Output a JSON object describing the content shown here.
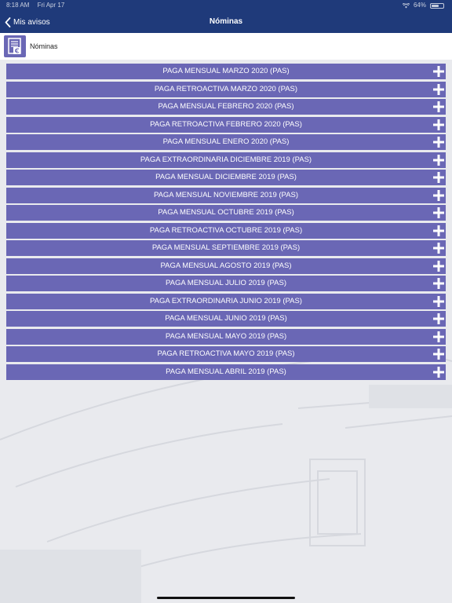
{
  "status_bar": {
    "time": "8:18 AM",
    "date": "Fri Apr 17",
    "battery": "64%",
    "battery_level": 0.64
  },
  "nav": {
    "back_label": "Mis avisos",
    "title": "Nóminas"
  },
  "section": {
    "title": "Nóminas",
    "icon": "payslip-euro-icon"
  },
  "rows": [
    {
      "label": "PAGA MENSUAL MARZO 2020 (PAS)"
    },
    {
      "label": "PAGA RETROACTIVA MARZO 2020 (PAS)"
    },
    {
      "label": "PAGA MENSUAL FEBRERO 2020 (PAS)"
    },
    {
      "label": "PAGA RETROACTIVA FEBRERO 2020 (PAS)"
    },
    {
      "label": "PAGA MENSUAL ENERO 2020 (PAS)"
    },
    {
      "label": "PAGA EXTRAORDINARIA DICIEMBRE 2019 (PAS)"
    },
    {
      "label": "PAGA MENSUAL DICIEMBRE 2019 (PAS)"
    },
    {
      "label": "PAGA MENSUAL NOVIEMBRE 2019 (PAS)"
    },
    {
      "label": "PAGA MENSUAL OCTUBRE 2019 (PAS)"
    },
    {
      "label": "PAGA RETROACTIVA OCTUBRE 2019 (PAS)"
    },
    {
      "label": "PAGA MENSUAL SEPTIEMBRE 2019 (PAS)"
    },
    {
      "label": "PAGA MENSUAL AGOSTO 2019 (PAS)"
    },
    {
      "label": "PAGA MENSUAL JULIO 2019 (PAS)"
    },
    {
      "label": "PAGA EXTRAORDINARIA JUNIO 2019 (PAS)"
    },
    {
      "label": "PAGA MENSUAL JUNIO 2019 (PAS)"
    },
    {
      "label": "PAGA MENSUAL MAYO 2019 (PAS)"
    },
    {
      "label": "PAGA RETROACTIVA MAYO 2019 (PAS)"
    },
    {
      "label": "PAGA MENSUAL ABRIL 2019 (PAS)"
    }
  ],
  "colors": {
    "nav_background": "#1f3a7a",
    "row_background": "#6a67b5",
    "row_text": "#ffffff",
    "page_background": "#e9eaee"
  },
  "icons": {
    "back": "chevron-left-icon",
    "expand": "plus-icon",
    "wifi": "wifi-icon",
    "battery": "battery-icon"
  }
}
